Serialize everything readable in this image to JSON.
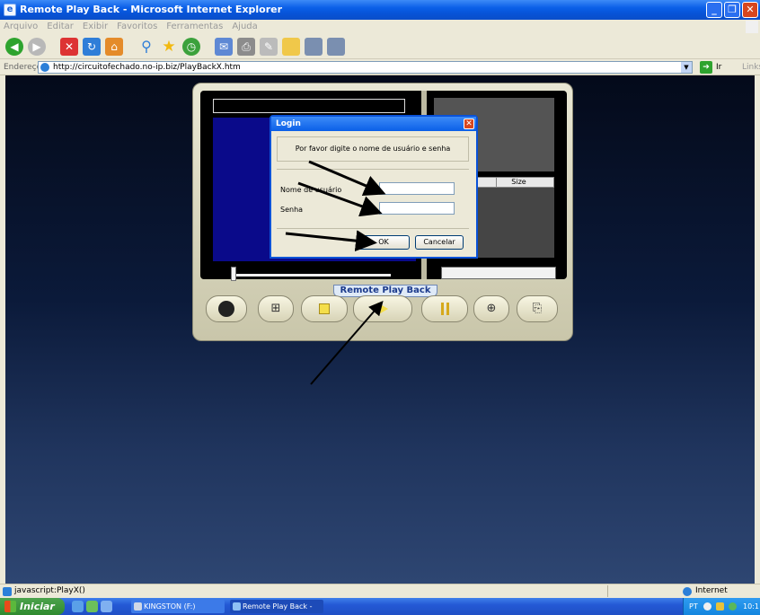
{
  "window": {
    "title": "Remote Play Back - Microsoft Internet Explorer",
    "minimize": "_",
    "restore": "❐",
    "close": "✕"
  },
  "menu": {
    "items": [
      "Arquivo",
      "Editar",
      "Exibir",
      "Favoritos",
      "Ferramentas",
      "Ajuda"
    ]
  },
  "address": {
    "label": "Endereço",
    "url": "http://circuitofechado.no-ip.biz/PlayBackX.htm",
    "go_label": "Ir",
    "links_label": "Links"
  },
  "player": {
    "brand": "Remote Play Back",
    "list_header_size": "Size",
    "buttons": [
      {
        "name": "camera-button",
        "icon": "aperture-icon"
      },
      {
        "name": "tree-button",
        "icon": "tree-icon"
      },
      {
        "name": "stop-button",
        "icon": "stop-icon"
      },
      {
        "name": "play-button",
        "icon": "play-icon"
      },
      {
        "name": "pause-button",
        "icon": "pause-icon"
      },
      {
        "name": "zoom-button",
        "icon": "zoom-icon"
      },
      {
        "name": "capture-button",
        "icon": "camera-icon"
      }
    ]
  },
  "login": {
    "title": "Login",
    "close": "✕",
    "prompt": "Por favor digite o nome de usuário e senha",
    "user_label": "Nome de usuário",
    "password_label": "Senha",
    "ok": "OK",
    "cancel": "Cancelar"
  },
  "status": {
    "text": "javascript:PlayX()",
    "zone": "Internet"
  },
  "taskbar": {
    "start": "Iniciar",
    "items": [
      "KINGSTON (F:)",
      "Remote Play Back - M..."
    ],
    "tray_lang": "PT",
    "clock": "10:1"
  },
  "colors": {
    "xp_blue": "#0a5fe8",
    "page_bg_top": "#040a1a",
    "page_bg_bottom": "#2e4672",
    "video_blue": "#0a0a8a"
  }
}
